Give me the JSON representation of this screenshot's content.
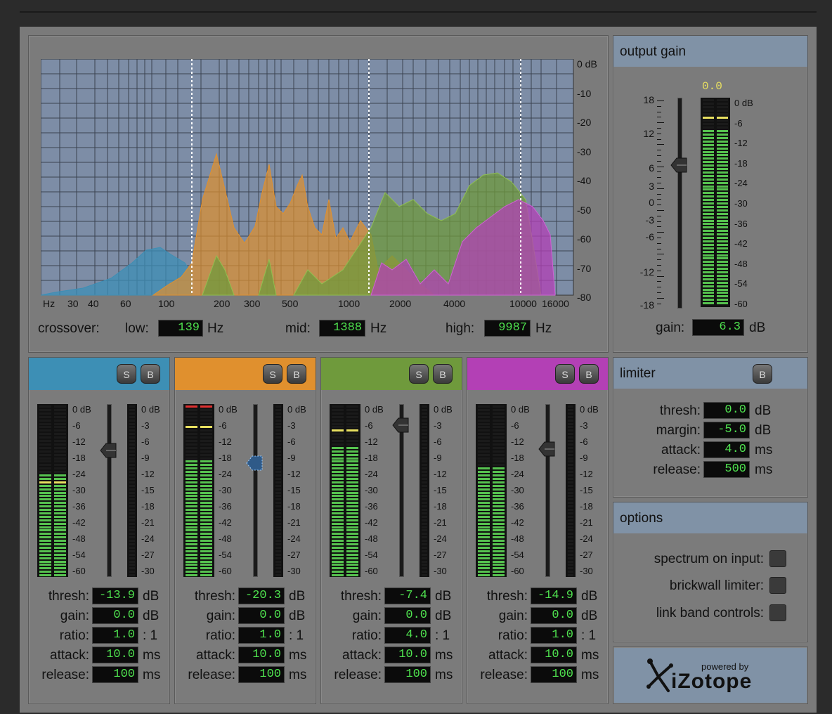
{
  "spectrum": {
    "db_labels": [
      "0 dB",
      "-10",
      "-20",
      "-30",
      "-40",
      "-50",
      "-60",
      "-70",
      "-80"
    ],
    "freq_labels": [
      "Hz",
      "30",
      "40",
      "60",
      "100",
      "200",
      "300",
      "500",
      "1000",
      "2000",
      "4000",
      "10000",
      "16000"
    ],
    "crossover_label": "crossover:",
    "low_label": "low:",
    "low_value": "139",
    "low_unit": "Hz",
    "mid_label": "mid:",
    "mid_value": "1388",
    "mid_unit": "Hz",
    "high_label": "high:",
    "high_value": "9987",
    "high_unit": "Hz"
  },
  "output_gain": {
    "title": "output gain",
    "peak_value": "0.0",
    "fader_scale": [
      "18",
      "12",
      "6",
      "3",
      "0",
      "-3",
      "-6",
      "-12",
      "-18"
    ],
    "meter_scale": [
      "0 dB",
      "-6",
      "-12",
      "-18",
      "-24",
      "-30",
      "-36",
      "-42",
      "-48",
      "-54",
      "-60"
    ],
    "gain_label": "gain:",
    "gain_value": "6.3",
    "gain_unit": "dB"
  },
  "band_meter_scale": [
    "0 dB",
    "-6",
    "-12",
    "-18",
    "-24",
    "-30",
    "-36",
    "-42",
    "-48",
    "-54",
    "-60"
  ],
  "band_gr_scale": [
    "0 dB",
    "-3",
    "-6",
    "-9",
    "-12",
    "-15",
    "-18",
    "-21",
    "-24",
    "-27",
    "-30"
  ],
  "band_labels": {
    "thresh": "thresh:",
    "gain": "gain:",
    "ratio": "ratio:",
    "attack": "attack:",
    "release": "release:",
    "db": "dB",
    "ratio_unit": ": 1",
    "ms": "ms"
  },
  "bands": [
    {
      "color": "#3d8fb5",
      "solo": "S",
      "bypass": "B",
      "thresh": "-13.9",
      "gain": "0.0",
      "ratio": "1.0",
      "attack": "10.0",
      "release": "100"
    },
    {
      "color": "#e0902e",
      "solo": "S",
      "bypass": "B",
      "thresh": "-20.3",
      "gain": "0.0",
      "ratio": "1.0",
      "attack": "10.0",
      "release": "100"
    },
    {
      "color": "#6f9a3c",
      "solo": "S",
      "bypass": "B",
      "thresh": "-7.4",
      "gain": "0.0",
      "ratio": "4.0",
      "attack": "10.0",
      "release": "100"
    },
    {
      "color": "#b340b5",
      "solo": "S",
      "bypass": "B",
      "thresh": "-14.9",
      "gain": "0.0",
      "ratio": "1.0",
      "attack": "10.0",
      "release": "100"
    }
  ],
  "limiter": {
    "title": "limiter",
    "bypass": "B",
    "thresh_label": "thresh:",
    "thresh_value": "0.0",
    "thresh_unit": "dB",
    "margin_label": "margin:",
    "margin_value": "-5.0",
    "margin_unit": "dB",
    "attack_label": "attack:",
    "attack_value": "4.0",
    "attack_unit": "ms",
    "release_label": "release:",
    "release_value": "500",
    "release_unit": "ms"
  },
  "options": {
    "title": "options",
    "spectrum_on_input": "spectrum on input:",
    "brickwall_limiter": "brickwall limiter:",
    "link_band_controls": "link band controls:"
  },
  "logo": {
    "powered_by": "powered by",
    "brand": "iZotope"
  }
}
